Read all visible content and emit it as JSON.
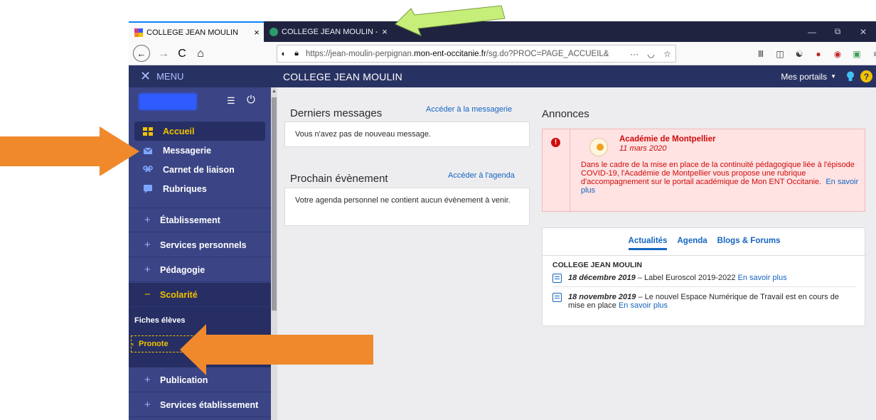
{
  "browser": {
    "tabs": [
      {
        "title": "COLLEGE JEAN MOULIN",
        "close": "×"
      },
      {
        "title": "COLLEGE JEAN MOULIN - PRO",
        "close": "×"
      }
    ],
    "window_controls": {
      "minimize": "—",
      "restore": "⧉",
      "close": "✕"
    },
    "url_prefix": "https://jean-moulin-perpignan.",
    "url_domain": "mon-ent-occitanie.fr",
    "url_suffix": "/sg.do?PROC=PAGE_ACCUEIL&",
    "url_more": "···",
    "nav": {
      "back": "←",
      "forward": "→",
      "reload": "C",
      "home": "⌂"
    }
  },
  "site": {
    "menu_label": "MENU",
    "title": "COLLEGE JEAN MOULIN",
    "portals_label": "Mes portails",
    "help_label": "?"
  },
  "sidebar": {
    "main_items": [
      {
        "label": "Accueil"
      },
      {
        "label": "Messagerie"
      },
      {
        "label": "Carnet de liaison"
      },
      {
        "label": "Rubriques"
      }
    ],
    "sections": [
      {
        "label": "Établissement",
        "sign": "+"
      },
      {
        "label": "Services personnels",
        "sign": "+"
      },
      {
        "label": "Pédagogie",
        "sign": "+"
      },
      {
        "label": "Scolarité",
        "sign": "−"
      },
      {
        "label": "Publication",
        "sign": "+"
      },
      {
        "label": "Services établissement",
        "sign": "+"
      }
    ],
    "scolarite_items": [
      {
        "label": "Fiches élèves"
      },
      {
        "label": "Pronote"
      }
    ]
  },
  "messages": {
    "title": "Derniers messages",
    "link": "Accéder à la messagerie",
    "empty": "Vous n'avez pas de nouveau message."
  },
  "events": {
    "title": "Prochain évènement",
    "link": "Accéder à l'agenda",
    "empty": "Votre agenda personnel ne contient aucun évènement à venir."
  },
  "annonces": {
    "title": "Annonces",
    "source": "Académie de Montpellier",
    "date": "11 mars 2020",
    "body": "Dans le cadre de la mise en place de la continuité pédagogique liée à l'épisode COVID-19, l'Académie de Montpellier vous propose une rubrique d'accompagnement sur le portail académique de Mon ENT Occitanie.",
    "more": "En savoir plus"
  },
  "news": {
    "tabs": [
      "Actualités",
      "Agenda",
      "Blogs & Forums"
    ],
    "org": "COLLEGE JEAN MOULIN",
    "items": [
      {
        "date": "18 décembre 2019",
        "text": " – Label Euroscol 2019-2022 ",
        "link": "En savoir plus"
      },
      {
        "date": "18 novembre 2019",
        "text": " – Le nouvel Espace Numérique de Travail est en cours de mise en place ",
        "link": "En savoir plus"
      }
    ]
  },
  "colors": {
    "topbar": "#283262",
    "sidebar": "#3b4585",
    "accent_yellow": "#f2c200",
    "link_blue": "#1565c0",
    "alert_red": "#cf0b0b",
    "arrow_orange": "#f0892c",
    "arrow_green": "#c6ef7a"
  }
}
